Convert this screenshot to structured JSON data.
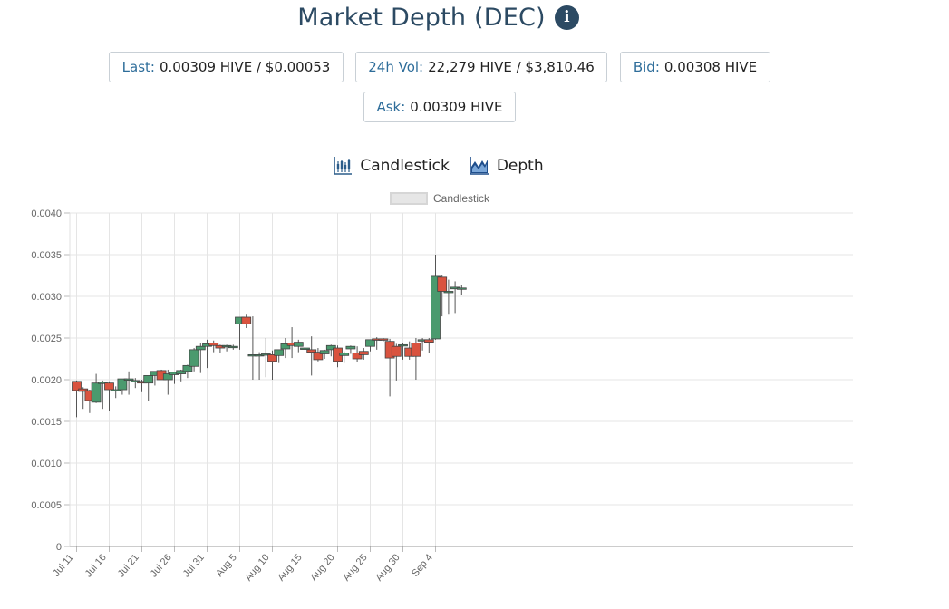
{
  "header": {
    "title": "Market Depth (DEC)",
    "info_icon": "info-circle-icon"
  },
  "stats": {
    "last": {
      "label": "Last:",
      "value": "0.00309 HIVE / $0.00053"
    },
    "vol": {
      "label": "24h Vol:",
      "value": "22,279 HIVE / $3,810.46"
    },
    "bid": {
      "label": "Bid:",
      "value": "0.00308 HIVE"
    },
    "ask": {
      "label": "Ask:",
      "value": "0.00309 HIVE"
    }
  },
  "modes": {
    "candlestick": {
      "label": "Candlestick",
      "icon": "candlestick-chart-icon"
    },
    "depth": {
      "label": "Depth",
      "icon": "area-chart-icon"
    }
  },
  "colors": {
    "up": "#4a9a6e",
    "down": "#d9533f",
    "wick": "#555555",
    "grid": "#e5e5e5"
  },
  "chart_data": {
    "type": "candlestick",
    "legend": [
      "Candlestick"
    ],
    "legend_position": "top",
    "grid": true,
    "ylim": [
      0,
      0.004
    ],
    "y_ticks": [
      "0",
      "0.0005",
      "0.0010",
      "0.0015",
      "0.0020",
      "0.0025",
      "0.0030",
      "0.0035",
      "0.0040"
    ],
    "x_ticks": [
      "Jul 11",
      "Jul 16",
      "Jul 21",
      "Jul 26",
      "Jul 31",
      "Aug 5",
      "Aug 10",
      "Aug 15",
      "Aug 20",
      "Aug 25",
      "Aug 30",
      "Sep 4"
    ],
    "dates": [
      "Jul 11",
      "Jul 12",
      "Jul 13",
      "Jul 14",
      "Jul 15",
      "Jul 16",
      "Jul 17",
      "Jul 18",
      "Jul 19",
      "Jul 20",
      "Jul 21",
      "Jul 22",
      "Jul 23",
      "Jul 24",
      "Jul 25",
      "Jul 26",
      "Jul 27",
      "Jul 28",
      "Jul 29",
      "Jul 30",
      "Jul 31",
      "Aug 1",
      "Aug 2",
      "Aug 3",
      "Aug 4",
      "Aug 5",
      "Aug 6",
      "Aug 7",
      "Aug 8",
      "Aug 9",
      "Aug 10",
      "Aug 11",
      "Aug 12",
      "Aug 13",
      "Aug 14",
      "Aug 15",
      "Aug 16",
      "Aug 17",
      "Aug 18",
      "Aug 19",
      "Aug 20",
      "Aug 21",
      "Aug 22",
      "Aug 23",
      "Aug 24",
      "Aug 25",
      "Aug 26",
      "Aug 27",
      "Aug 28",
      "Aug 29",
      "Aug 30",
      "Aug 31",
      "Sep 1",
      "Sep 2",
      "Sep 3",
      "Sep 4",
      "Sep 5",
      "Sep 6",
      "Sep 7",
      "Sep 8"
    ],
    "open": [
      0.00198,
      0.00189,
      0.00187,
      0.00173,
      0.00197,
      0.00196,
      0.00188,
      0.00188,
      0.002,
      0.00199,
      0.00198,
      0.00196,
      0.00205,
      0.00211,
      0.002,
      0.00206,
      0.00207,
      0.0021,
      0.00216,
      0.00236,
      0.0024,
      0.00244,
      0.00241,
      0.0024,
      0.0024,
      0.00267,
      0.00275,
      0.00229,
      0.00229,
      0.0023,
      0.0023,
      0.00229,
      0.00237,
      0.00244,
      0.0024,
      0.00238,
      0.00236,
      0.00233,
      0.00231,
      0.00236,
      0.00238,
      0.00229,
      0.00237,
      0.00232,
      0.00234,
      0.0024,
      0.00249,
      0.00249,
      0.00246,
      0.0024,
      0.00241,
      0.00238,
      0.00244,
      0.00247,
      0.00248,
      0.00249,
      0.00323,
      0.00306,
      0.00309,
      0.0031
    ],
    "high": [
      0.00199,
      0.00191,
      0.00188,
      0.00207,
      0.00199,
      0.00198,
      0.00192,
      0.00198,
      0.0021,
      0.00202,
      0.002,
      0.00198,
      0.00209,
      0.00212,
      0.00212,
      0.00209,
      0.00212,
      0.00218,
      0.00238,
      0.00244,
      0.00248,
      0.00247,
      0.00242,
      0.00242,
      0.00242,
      0.00274,
      0.00278,
      0.00276,
      0.00233,
      0.0025,
      0.00235,
      0.00233,
      0.0025,
      0.00263,
      0.00248,
      0.00248,
      0.00252,
      0.00238,
      0.00236,
      0.00242,
      0.00241,
      0.00234,
      0.00241,
      0.0024,
      0.00238,
      0.00244,
      0.00251,
      0.0025,
      0.00249,
      0.00243,
      0.00244,
      0.00246,
      0.0025,
      0.0025,
      0.0025,
      0.0035,
      0.00325,
      0.0032,
      0.00318,
      0.00314
    ],
    "low": [
      0.00155,
      0.00165,
      0.0016,
      0.00172,
      0.00165,
      0.00162,
      0.00178,
      0.00182,
      0.00182,
      0.0019,
      0.00185,
      0.00174,
      0.00193,
      0.002,
      0.00182,
      0.00195,
      0.00198,
      0.00202,
      0.0021,
      0.00208,
      0.00214,
      0.00233,
      0.00232,
      0.00234,
      0.00236,
      0.00236,
      0.00262,
      0.002,
      0.002,
      0.00203,
      0.002,
      0.0022,
      0.00226,
      0.00226,
      0.00233,
      0.00226,
      0.00205,
      0.00222,
      0.00225,
      0.00228,
      0.00215,
      0.0022,
      0.00231,
      0.00221,
      0.00224,
      0.00234,
      0.00236,
      0.00246,
      0.0018,
      0.00199,
      0.00224,
      0.00224,
      0.002,
      0.00235,
      0.00232,
      0.00248,
      0.00276,
      0.00278,
      0.0028,
      0.00302
    ],
    "close": [
      0.00187,
      0.00186,
      0.00175,
      0.00196,
      0.00197,
      0.00188,
      0.00188,
      0.00201,
      0.00201,
      0.00199,
      0.00196,
      0.00205,
      0.0021,
      0.002,
      0.00207,
      0.00209,
      0.00211,
      0.00217,
      0.00236,
      0.0024,
      0.00243,
      0.00241,
      0.00238,
      0.00241,
      0.0024,
      0.00275,
      0.00267,
      0.0023,
      0.0023,
      0.00231,
      0.00222,
      0.00236,
      0.00243,
      0.00241,
      0.00245,
      0.00238,
      0.00233,
      0.00224,
      0.00235,
      0.00241,
      0.00222,
      0.00232,
      0.0024,
      0.00225,
      0.0023,
      0.00248,
      0.00248,
      0.00248,
      0.00226,
      0.00228,
      0.00242,
      0.00228,
      0.00228,
      0.00248,
      0.00245,
      0.00324,
      0.00306,
      0.00306,
      0.00311,
      0.0031
    ]
  }
}
